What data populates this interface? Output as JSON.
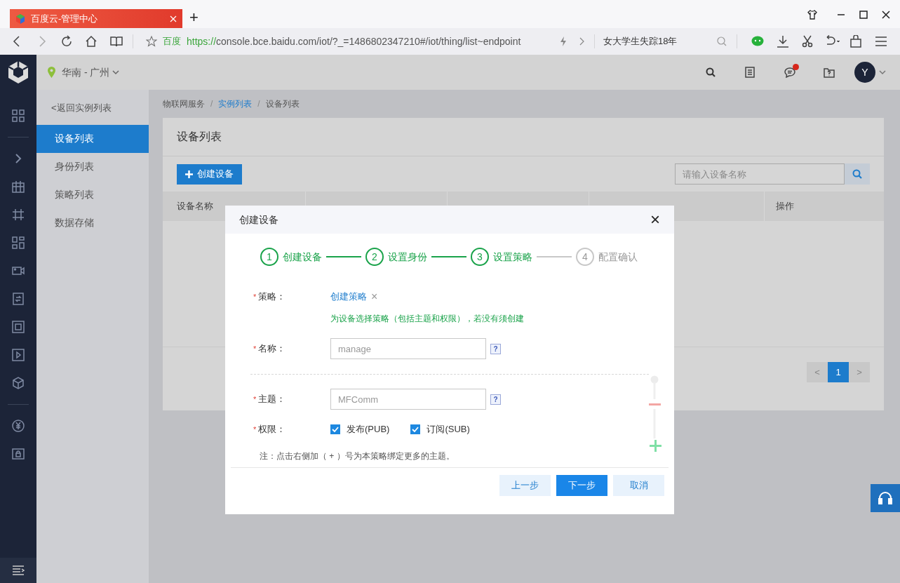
{
  "browser": {
    "tab_title": "百度云-管理中心",
    "new_tab": "+",
    "site_label": "百度",
    "url_scheme": "https://",
    "url_rest": "console.bce.baidu.com/iot/?_=1486802347210#/iot/thing/list~endpoint",
    "search_text": "女大学生失踪18年"
  },
  "header": {
    "region": "华南 - 广州",
    "avatar": "Y",
    "notification": true
  },
  "sidebar": {
    "back_link": "<返回实例列表",
    "items": [
      {
        "label": "设备列表",
        "selected": true
      },
      {
        "label": "身份列表",
        "selected": false
      },
      {
        "label": "策略列表",
        "selected": false
      },
      {
        "label": "数据存储",
        "selected": false
      }
    ]
  },
  "breadcrumb": [
    {
      "label": "物联网服务",
      "kind": "text"
    },
    {
      "label": "实例列表",
      "kind": "link"
    },
    {
      "label": "设备列表",
      "kind": "text"
    }
  ],
  "breadcrumb_separator": "/",
  "card": {
    "title": "设备列表",
    "create_button": "创建设备",
    "search": {
      "placeholder": "请输入设备名称"
    },
    "table": {
      "columns": [
        "设备名称",
        "操作"
      ]
    },
    "pagination": {
      "prev": "<",
      "pages": [
        {
          "label": "1",
          "selected": true
        }
      ],
      "next": ">"
    }
  },
  "dialog": {
    "title": "创建设备",
    "close": "×",
    "required_mark": "*",
    "steps": [
      {
        "number": "1",
        "label": "创建设备",
        "done": true
      },
      {
        "number": "2",
        "label": "设置身份",
        "done": true
      },
      {
        "number": "3",
        "label": "设置策略",
        "done": true
      },
      {
        "number": "4",
        "label": "配置确认",
        "done": false
      }
    ],
    "policy": {
      "label": "策略：",
      "required": true,
      "link": "创建策略",
      "remove": "×",
      "hint": "为设备选择策略（包括主题和权限），若没有须创建"
    },
    "name": {
      "label": "名称：",
      "required": true,
      "placeholder": "manage",
      "help": "?"
    },
    "topic": {
      "label": "主题：",
      "required": true,
      "placeholder": "MFComm",
      "help": "?"
    },
    "permissions": {
      "label": "权限：",
      "required": true,
      "options": [
        {
          "label": "发布(PUB)",
          "checked": true
        },
        {
          "label": "订阅(SUB)",
          "checked": true
        }
      ]
    },
    "note": "注：点击右侧加（ + ）号为本策略绑定更多的主题。",
    "buttons": [
      {
        "label": "上一步",
        "kind": "secondary"
      },
      {
        "label": "下一步",
        "kind": "primary"
      },
      {
        "label": "取消",
        "kind": "secondary"
      }
    ]
  }
}
